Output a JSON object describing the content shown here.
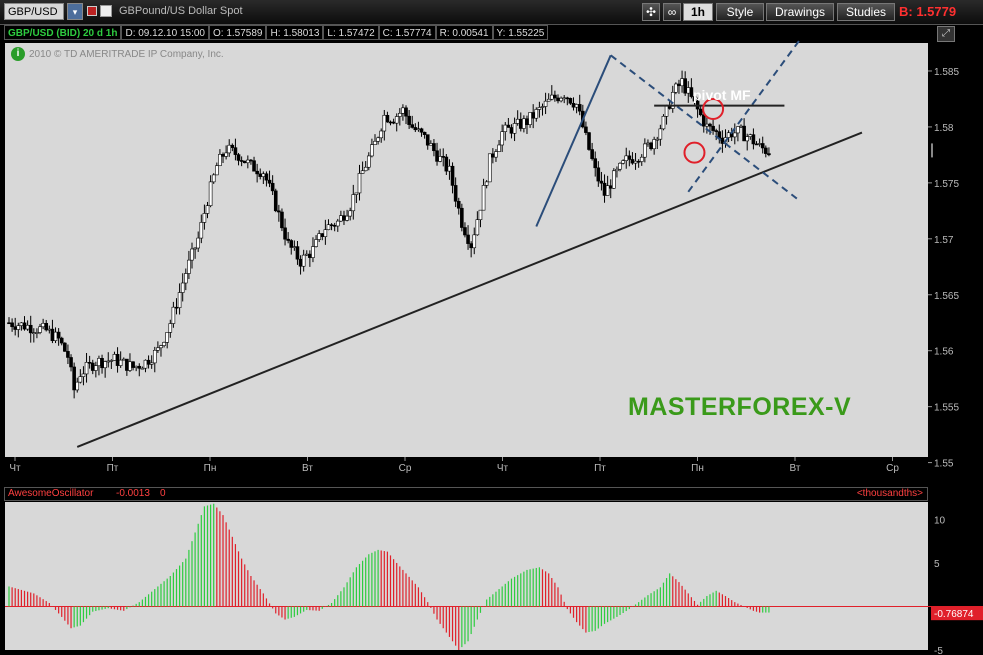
{
  "toolbar": {
    "symbol": "GBP/USD",
    "description": "GBPound/US Dollar Spot",
    "timeframe": "1h",
    "style_label": "Style",
    "drawings_label": "Drawings",
    "studies_label": "Studies",
    "bid_label": "B: 1.5779",
    "icons": [
      "chevron-down-icon",
      "bookmark-icon",
      "color-icon",
      "crosshair-icon",
      "link-icon",
      "expand-icon"
    ]
  },
  "info": {
    "symbol_period": "GBP/USD (BID) 20 d 1h",
    "date": "D: 09.12.10 15:00",
    "open": "O: 1.57589",
    "high": "H: 1.58013",
    "low": "L: 1.57472",
    "close": "C: 1.57774",
    "range": "R: 0.00541",
    "y": "Y: 1.55225"
  },
  "copyright": "2010 © TD AMERITRADE IP Company, Inc.",
  "oscillator": {
    "name": "AwesomeOscillator",
    "value": "-0.0013",
    "zero": "0",
    "units": "<thousandths>",
    "current_label": "-0.76874"
  },
  "annotations": {
    "watermark": "MASTERFOREX-V",
    "pivot_label": "pivot MF"
  },
  "colors": {
    "up_candle": "#ffffff",
    "down_candle": "#000000",
    "osc_up": "#2ecc40",
    "osc_down": "#e0202a",
    "trendline": "#222222",
    "pattern": "#2b4d7a",
    "circle": "#e0202a"
  },
  "chart_data": [
    {
      "type": "candlestick",
      "title": "GBP/USD (BID) 20 d 1h",
      "ylim": [
        1.5505,
        1.5875
      ],
      "y_ticks": [
        1.585,
        1.58,
        1.575,
        1.57,
        1.565,
        1.56,
        1.555,
        1.55
      ],
      "x_tick_labels": [
        "Чт",
        "Пт",
        "Пн",
        "Вт",
        "Ср",
        "Чт",
        "Пт",
        "Пн",
        "Вт",
        "Ср"
      ],
      "close_path": [
        [
          0,
          1.5625
        ],
        [
          6,
          1.5622
        ],
        [
          12,
          1.5618
        ],
        [
          16,
          1.561
        ],
        [
          19,
          1.5595
        ],
        [
          21,
          1.5565
        ],
        [
          23,
          1.558
        ],
        [
          28,
          1.559
        ],
        [
          34,
          1.5592
        ],
        [
          40,
          1.5585
        ],
        [
          44,
          1.559
        ],
        [
          48,
          1.56
        ],
        [
          52,
          1.5625
        ],
        [
          57,
          1.567
        ],
        [
          61,
          1.57
        ],
        [
          64,
          1.5735
        ],
        [
          67,
          1.5765
        ],
        [
          70,
          1.578
        ],
        [
          74,
          1.5775
        ],
        [
          78,
          1.5765
        ],
        [
          82,
          1.576
        ],
        [
          86,
          1.573
        ],
        [
          90,
          1.5695
        ],
        [
          94,
          1.568
        ],
        [
          98,
          1.569
        ],
        [
          102,
          1.571
        ],
        [
          106,
          1.5715
        ],
        [
          110,
          1.573
        ],
        [
          114,
          1.576
        ],
        [
          118,
          1.5785
        ],
        [
          121,
          1.581
        ],
        [
          124,
          1.5808
        ],
        [
          127,
          1.5815
        ],
        [
          130,
          1.58
        ],
        [
          134,
          1.579
        ],
        [
          138,
          1.5775
        ],
        [
          142,
          1.576
        ],
        [
          146,
          1.5715
        ],
        [
          149,
          1.5695
        ],
        [
          152,
          1.573
        ],
        [
          155,
          1.577
        ],
        [
          159,
          1.5795
        ],
        [
          163,
          1.58
        ],
        [
          167,
          1.5805
        ],
        [
          171,
          1.5815
        ],
        [
          175,
          1.5825
        ],
        [
          179,
          1.583
        ],
        [
          183,
          1.582
        ],
        [
          186,
          1.579
        ],
        [
          189,
          1.576
        ],
        [
          192,
          1.574
        ],
        [
          195,
          1.5755
        ],
        [
          199,
          1.577
        ],
        [
          203,
          1.5775
        ],
        [
          207,
          1.5785
        ],
        [
          211,
          1.5805
        ],
        [
          214,
          1.583
        ],
        [
          217,
          1.584
        ],
        [
          219,
          1.583
        ],
        [
          222,
          1.5815
        ],
        [
          225,
          1.58
        ],
        [
          228,
          1.5795
        ],
        [
          230,
          1.579
        ],
        [
          233,
          1.5795
        ],
        [
          236,
          1.5795
        ],
        [
          239,
          1.579
        ],
        [
          242,
          1.5782
        ],
        [
          245,
          1.5778
        ]
      ]
    },
    {
      "type": "bar",
      "title": "AwesomeOscillator",
      "units": "thousandths",
      "ylim": [
        -5,
        12
      ],
      "y_ticks": [
        10,
        5,
        -5
      ],
      "path": [
        [
          0,
          2.3
        ],
        [
          8,
          1.5
        ],
        [
          13,
          0.4
        ],
        [
          17,
          -1.2
        ],
        [
          20,
          -2.5
        ],
        [
          23,
          -2.2
        ],
        [
          27,
          -0.6
        ],
        [
          32,
          -0.2
        ],
        [
          37,
          -0.5
        ],
        [
          42,
          0.5
        ],
        [
          47,
          2.0
        ],
        [
          52,
          3.5
        ],
        [
          57,
          5.5
        ],
        [
          60,
          8.5
        ],
        [
          63,
          11.5
        ],
        [
          66,
          11.8
        ],
        [
          69,
          10.5
        ],
        [
          72,
          8.0
        ],
        [
          75,
          5.5
        ],
        [
          78,
          3.5
        ],
        [
          82,
          1.5
        ],
        [
          86,
          -0.8
        ],
        [
          89,
          -1.5
        ],
        [
          92,
          -1.2
        ],
        [
          96,
          -0.4
        ],
        [
          100,
          -0.5
        ],
        [
          104,
          0.4
        ],
        [
          108,
          2.2
        ],
        [
          112,
          4.5
        ],
        [
          116,
          6.0
        ],
        [
          119,
          6.5
        ],
        [
          122,
          6.3
        ],
        [
          125,
          5.0
        ],
        [
          128,
          3.8
        ],
        [
          132,
          2.2
        ],
        [
          135,
          0.5
        ],
        [
          138,
          -1.5
        ],
        [
          142,
          -3.5
        ],
        [
          145,
          -5.0
        ],
        [
          148,
          -4.0
        ],
        [
          151,
          -1.5
        ],
        [
          154,
          0.8
        ],
        [
          158,
          2.0
        ],
        [
          162,
          3.2
        ],
        [
          167,
          4.2
        ],
        [
          171,
          4.5
        ],
        [
          174,
          3.8
        ],
        [
          177,
          2.2
        ],
        [
          180,
          -0.3
        ],
        [
          183,
          -1.8
        ],
        [
          186,
          -3.0
        ],
        [
          189,
          -2.8
        ],
        [
          192,
          -2.0
        ],
        [
          196,
          -1.2
        ],
        [
          200,
          -0.3
        ],
        [
          203,
          0.5
        ],
        [
          206,
          1.3
        ],
        [
          210,
          2.2
        ],
        [
          213,
          3.8
        ],
        [
          216,
          2.8
        ],
        [
          219,
          1.5
        ],
        [
          222,
          0.2
        ],
        [
          225,
          1.2
        ],
        [
          228,
          1.8
        ],
        [
          231,
          1.2
        ],
        [
          234,
          0.5
        ],
        [
          237,
          0.0
        ],
        [
          240,
          -0.5
        ],
        [
          242,
          -0.7
        ]
      ]
    }
  ]
}
